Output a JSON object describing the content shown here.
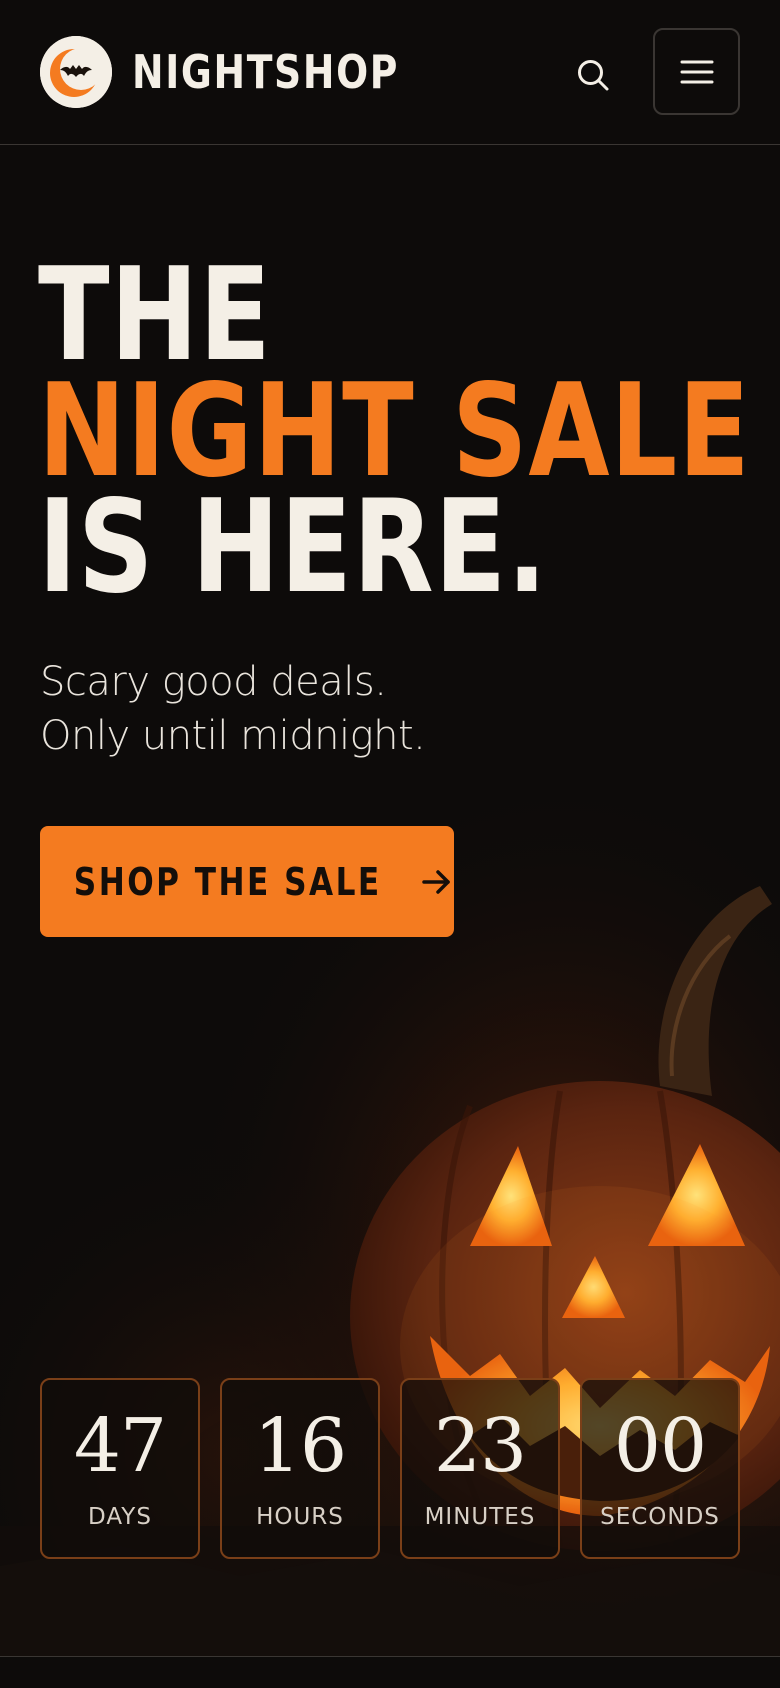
{
  "header": {
    "brand": "NIGHTSHOP",
    "logo_icon": "moon-bat-logo-icon",
    "search_icon": "search-icon",
    "menu_icon": "hamburger-menu-icon"
  },
  "hero": {
    "headline_line1": "THE",
    "headline_line2": "NIGHT SALE",
    "headline_line3": "IS HERE.",
    "subtitle_line1": "Scary good deals.",
    "subtitle_line2": "Only until midnight.",
    "cta_label": "SHOP THE SALE",
    "cta_icon": "arrow-right-icon",
    "image": "jack-o-lantern pumpkin in smoke"
  },
  "countdown": [
    {
      "value": "47",
      "label": "DAYS"
    },
    {
      "value": "16",
      "label": "HOURS"
    },
    {
      "value": "23",
      "label": "MINUTES"
    },
    {
      "value": "00",
      "label": "SECONDS"
    }
  ],
  "colors": {
    "background": "#0d0b0a",
    "accent": "#f47b20",
    "text": "#f4efe6",
    "border": "#3a3633"
  }
}
